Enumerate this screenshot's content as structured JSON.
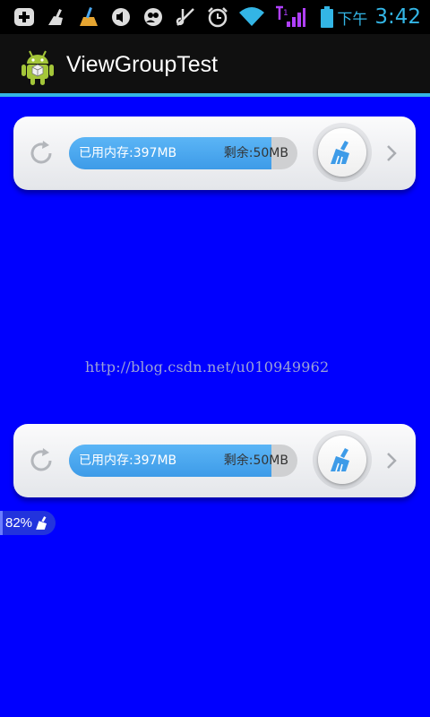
{
  "status_bar": {
    "carrier_text": "下午",
    "time": "3:42",
    "icons": [
      "add-icon",
      "clean-icon",
      "broom-icon",
      "volume-icon",
      "contacts-icon",
      "mute-icon",
      "alarm-icon",
      "wifi-icon",
      "signal-icon",
      "battery-icon"
    ]
  },
  "action_bar": {
    "title": "ViewGroupTest",
    "icon": "android-icon",
    "accent_color": "#33b5e5"
  },
  "memory_widgets": [
    {
      "used_label": "已用内存:397MB",
      "free_label": "剩余:50MB",
      "used_fraction": 0.887
    },
    {
      "used_label": "已用内存:397MB",
      "free_label": "剩余:50MB",
      "used_fraction": 0.887
    }
  ],
  "watermark": "http://blog.csdn.net/u010949962",
  "float_badge": {
    "percent": "82%"
  },
  "colors": {
    "background": "#0000ff",
    "bar_fill": "#4aa8f0",
    "bar_track": "#cfd0d2"
  }
}
